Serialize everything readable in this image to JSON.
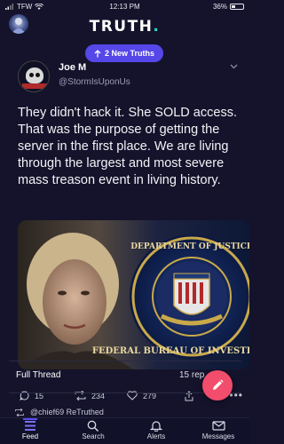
{
  "status_bar": {
    "carrier": "TFW",
    "time": "12:13 PM",
    "battery": "36%",
    "battery_level": 0.36
  },
  "header": {
    "logo_text": "TRUTH",
    "logo_dot": "."
  },
  "new_truths_pill": {
    "label": "2 New Truths",
    "icon": "arrow-up-icon",
    "color": "#5547e8"
  },
  "post": {
    "author_name": "Joe M",
    "author_handle": "@StormIsUponUs",
    "text": "They didn't hack it. She SOLD access. That was the purpose of getting the server in the first place. We are living through the largest and most severe mass treason event in living history.",
    "actions": {
      "replies": "15",
      "retruths": "234",
      "likes": "279"
    }
  },
  "thread": {
    "label": "Full Thread",
    "replies_text": "15 rep"
  },
  "next_post": {
    "retruth_text": "@chief69 ReTruthed"
  },
  "tabs": [
    {
      "label": "Feed",
      "icon": "feed-icon",
      "active": true
    },
    {
      "label": "Search",
      "icon": "search-icon",
      "active": false
    },
    {
      "label": "Alerts",
      "icon": "bell-icon",
      "active": false
    },
    {
      "label": "Messages",
      "icon": "mail-icon",
      "active": false
    }
  ],
  "colors": {
    "background": "#14132b",
    "accent": "#5547e8",
    "fab": "#f24d6c",
    "logo_dot": "#27d8c7"
  }
}
